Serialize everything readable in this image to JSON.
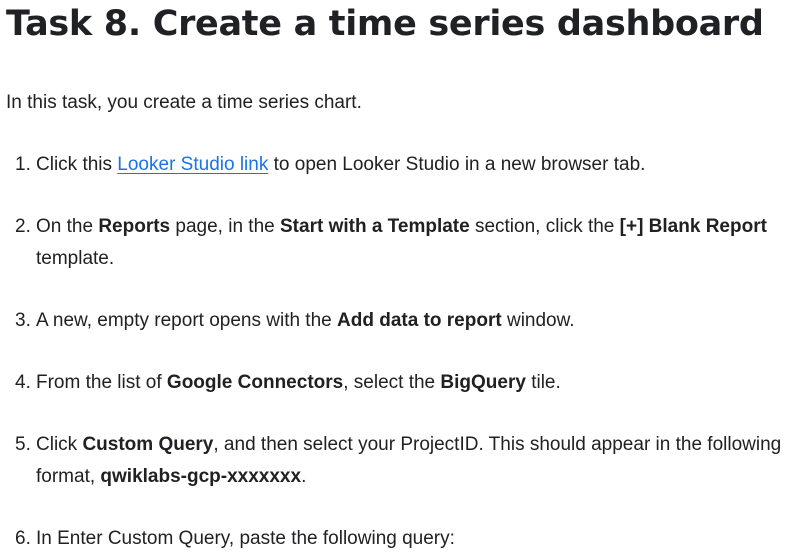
{
  "title": "Task 8. Create a time series dashboard",
  "intro": "In this task, you create a time series chart.",
  "steps": [
    {
      "num": "1.",
      "parts": [
        {
          "t": "Click this "
        },
        {
          "t": "Looker Studio link",
          "link": true
        },
        {
          "t": " to open Looker Studio in a new browser tab."
        }
      ]
    },
    {
      "num": "2.",
      "parts": [
        {
          "t": "On the "
        },
        {
          "t": "Reports",
          "bold": true
        },
        {
          "t": " page, in the "
        },
        {
          "t": "Start with a Template",
          "bold": true
        },
        {
          "t": " section, click the "
        },
        {
          "t": "[+] Blank Report",
          "bold": true
        },
        {
          "t": " template."
        }
      ]
    },
    {
      "num": "3.",
      "parts": [
        {
          "t": "A new, empty report opens with the "
        },
        {
          "t": "Add data to report",
          "bold": true
        },
        {
          "t": " window."
        }
      ]
    },
    {
      "num": "4.",
      "parts": [
        {
          "t": "From the list of "
        },
        {
          "t": "Google Connectors",
          "bold": true
        },
        {
          "t": ", select the "
        },
        {
          "t": "BigQuery",
          "bold": true
        },
        {
          "t": " tile."
        }
      ]
    },
    {
      "num": "5.",
      "parts": [
        {
          "t": "Click "
        },
        {
          "t": "Custom Query",
          "bold": true
        },
        {
          "t": ", and then select your ProjectID. This should appear in the following format, "
        },
        {
          "t": "qwiklabs-gcp-xxxxxxx",
          "bold": true
        },
        {
          "t": "."
        }
      ]
    },
    {
      "num": "6.",
      "parts": [
        {
          "t": "In Enter Custom Query, paste the following query:"
        }
      ]
    }
  ],
  "colors": {
    "text": "#202124",
    "link": "#1a73e8",
    "background": "#ffffff"
  }
}
